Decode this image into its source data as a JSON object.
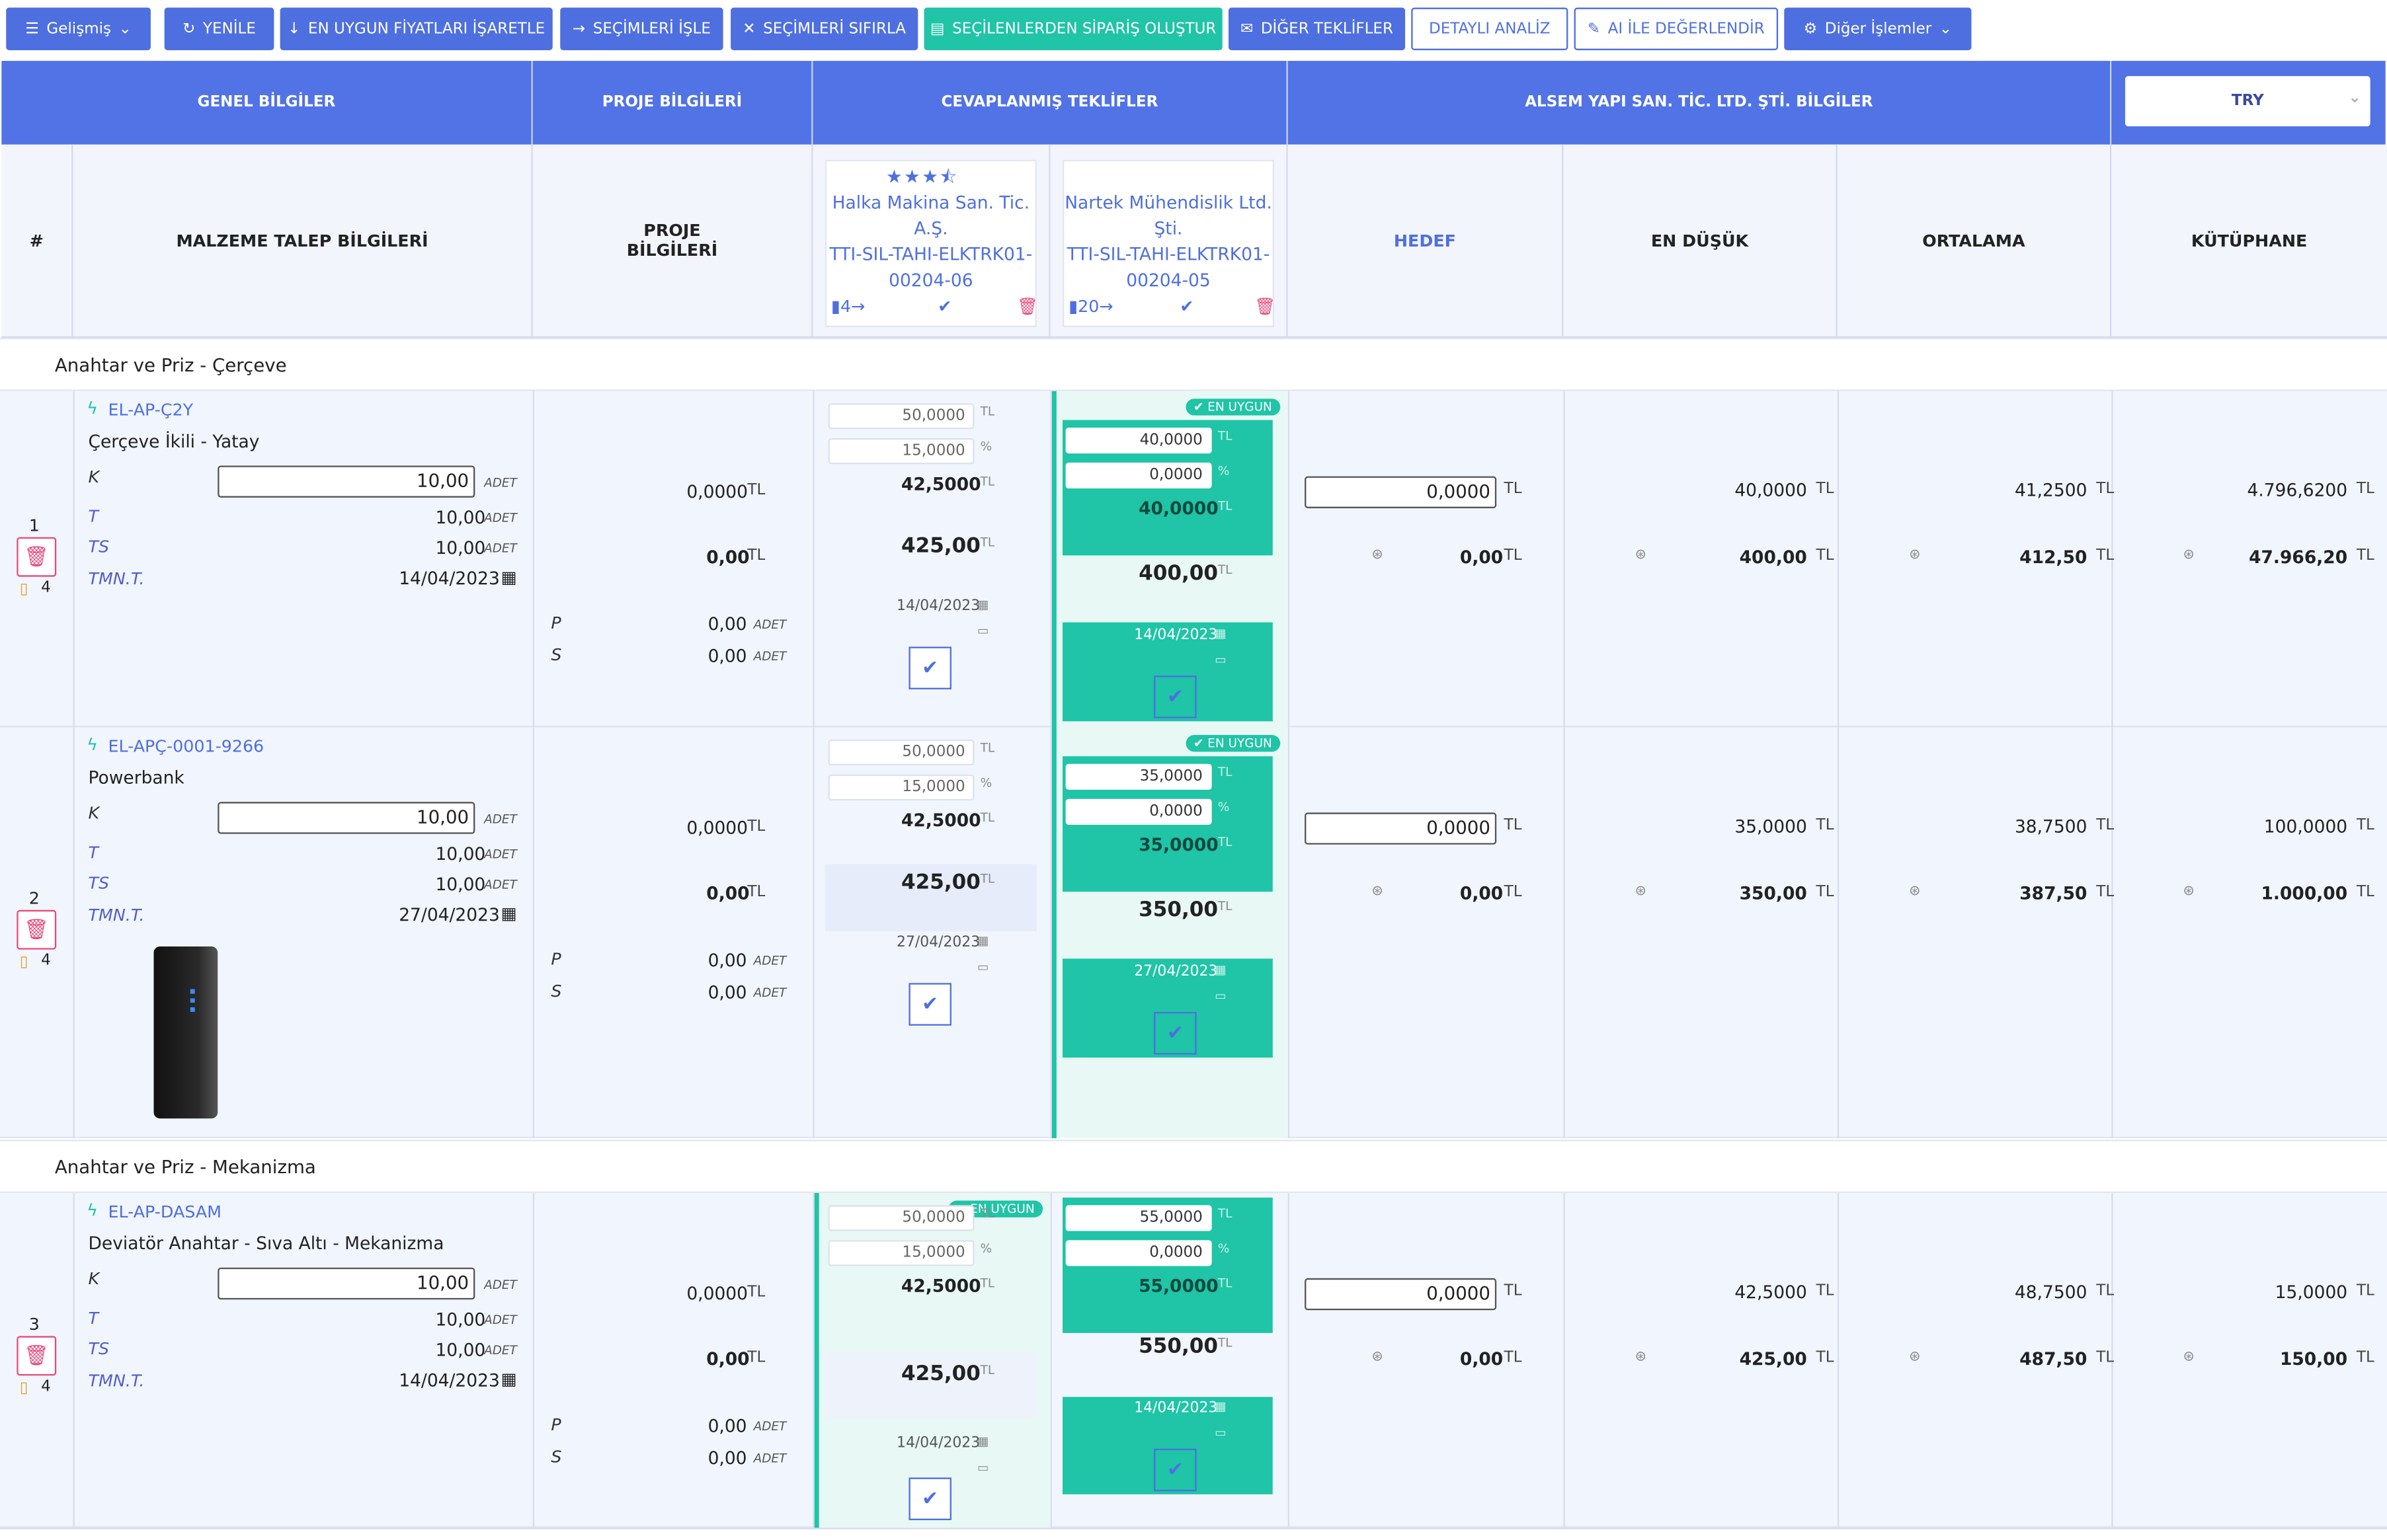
{
  "toolbar": {
    "advanced": "Gelişmiş",
    "refresh": "YENİLE",
    "mark_best": "EN UYGUN FİYATLARI İŞARETLE",
    "process": "SEÇİMLERİ İŞLE",
    "reset": "SEÇİMLERİ SIFIRLA",
    "create_order": "SEÇİLENLERDEN SİPARİŞ OLUŞTUR",
    "other_offers": "DİĞER TEKLİFLER",
    "detailed": "DETAYLI ANALİZ",
    "ai": "AI İLE DEĞERLENDİR",
    "other_actions": "Diğer İşlemler"
  },
  "header": {
    "general": "GENEL BİLGİLER",
    "project": "PROJE BİLGİLERİ",
    "answered": "CEVAPLANMIŞ TEKLİFLER",
    "company": "ALSEM YAPI SAN. TİC. LTD. ŞTİ. BİLGİLER",
    "currency": "TRY",
    "col_hash": "#",
    "col_material": "MALZEME TALEP BİLGİLERİ",
    "col_project_l1": "PROJE",
    "col_project_l2": "BİLGİLERİ",
    "col_target": "HEDEF",
    "col_lowest": "EN DÜŞÜK",
    "col_average": "ORTALAMA",
    "col_library": "KÜTÜPHANE"
  },
  "suppliers": [
    {
      "name_l1": "Halka Makina San. Tic.",
      "name_l2": "A.Ş.",
      "code_l1": "TTI-SIL-TAHI-ELKTRK01-",
      "code_l2": "00204-06",
      "doc_count": "4",
      "rating": 3.5
    },
    {
      "name_l1": "Nartek Mühendislik Ltd.",
      "name_l2": "Şti.",
      "code_l1": "TTI-SIL-TAHI-ELKTRK01-",
      "code_l2": "00204-05",
      "doc_count": "20"
    }
  ],
  "labels": {
    "k": "K",
    "t": "T",
    "ts": "TS",
    "tmnt": "TMN.T.",
    "p": "P",
    "s": "S",
    "adet": "ADET",
    "tl": "TL",
    "pct": "%",
    "best": "EN UYGUN",
    "note_count": "4"
  },
  "groups": [
    "Anahtar ve Priz - Çerçeve",
    "Anahtar ve Priz - Mekanizma"
  ],
  "rows": [
    {
      "no": "1",
      "code": "EL-AP-Ç2Y",
      "name": "Çerçeve İkili - Yatay",
      "k": "10,00",
      "t": "10,00",
      "ts": "10,00",
      "date": "14/04/2023",
      "proj_price": "0,0000",
      "proj_total": "0,00",
      "p": "0,00",
      "s": "0,00",
      "o1": {
        "price": "50,0000",
        "disc": "15,0000",
        "net": "42,5000",
        "total": "425,00",
        "date": "14/04/2023"
      },
      "o2": {
        "price": "40,0000",
        "disc": "0,0000",
        "net": "40,0000",
        "total": "400,00",
        "date": "14/04/2023"
      },
      "target": "0,0000",
      "target_total": "0,00",
      "lowest": "40,0000",
      "lowest_total": "400,00",
      "avg": "41,2500",
      "avg_total": "412,50",
      "lib": "4.796,6200",
      "lib_total": "47.966,20"
    },
    {
      "no": "2",
      "code": "EL-APÇ-0001-9266",
      "name": "Powerbank",
      "k": "10,00",
      "t": "10,00",
      "ts": "10,00",
      "date": "27/04/2023",
      "proj_price": "0,0000",
      "proj_total": "0,00",
      "p": "0,00",
      "s": "0,00",
      "o1": {
        "price": "50,0000",
        "disc": "15,0000",
        "net": "42,5000",
        "total": "425,00",
        "date": "27/04/2023"
      },
      "o2": {
        "price": "35,0000",
        "disc": "0,0000",
        "net": "35,0000",
        "total": "350,00",
        "date": "27/04/2023"
      },
      "target": "0,0000",
      "target_total": "0,00",
      "lowest": "35,0000",
      "lowest_total": "350,00",
      "avg": "38,7500",
      "avg_total": "387,50",
      "lib": "100,0000",
      "lib_total": "1.000,00"
    },
    {
      "no": "3",
      "code": "EL-AP-DASAM",
      "name": "Deviatör Anahtar - Sıva Altı - Mekanizma",
      "k": "10,00",
      "t": "10,00",
      "ts": "10,00",
      "date": "14/04/2023",
      "proj_price": "0,0000",
      "proj_total": "0,00",
      "p": "0,00",
      "s": "0,00",
      "o1": {
        "price": "50,0000",
        "disc": "15,0000",
        "net": "42,5000",
        "total": "425,00",
        "date": "14/04/2023"
      },
      "o2": {
        "price": "55,0000",
        "disc": "0,0000",
        "net": "55,0000",
        "total": "550,00",
        "date": "14/04/2023"
      },
      "target": "0,0000",
      "target_total": "0,00",
      "lowest": "42,5000",
      "lowest_total": "425,00",
      "avg": "48,7500",
      "avg_total": "487,50",
      "lib": "15,0000",
      "lib_total": "150,00"
    }
  ],
  "colors": {
    "primary": "#4e6fe0",
    "teal": "#20c4a7",
    "danger": "#e84a7a"
  }
}
